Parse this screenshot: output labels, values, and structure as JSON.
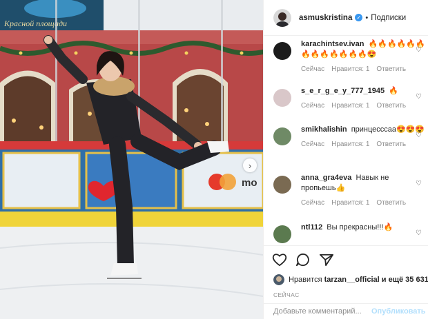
{
  "photo": {
    "sign_text": "Красной площади",
    "ad_text": "mo"
  },
  "header": {
    "username": "asmuskristina",
    "verified_mark": "✓",
    "separator": "•",
    "follow_label": "Подписки"
  },
  "comments": [
    {
      "username": "karachintsev.ivan",
      "text": "🔥🔥🔥🔥🔥🔥🔥🔥🔥🔥🔥🔥🔥😍",
      "time": "Сейчас",
      "likes": "Нравится: 1",
      "reply": "Ответить",
      "avatar_color": "#1b1b1b"
    },
    {
      "username": "s_e_r_g_e_y_777_1945",
      "text": "🔥",
      "time": "Сейчас",
      "likes": "Нравится: 1",
      "reply": "Ответить",
      "avatar_color": "#d9c7c9"
    },
    {
      "username": "smikhalishin",
      "text": "принцесссаа😍😍😍",
      "time": "Сейчас",
      "likes": "Нравится: 1",
      "reply": "Ответить",
      "avatar_color": "#6f8a66"
    },
    {
      "username": "anna_gra4eva",
      "text": "Навык не пропьешь👍",
      "time": "Сейчас",
      "likes": "Нравится: 1",
      "reply": "Ответить",
      "avatar_color": "#7a6a52"
    },
    {
      "username": "ntl112",
      "text": "Вы прекрасны!!!🔥",
      "time": "",
      "likes": "",
      "reply": "",
      "avatar_color": "#5b7a4f"
    }
  ],
  "likes_line": {
    "prefix": "Нравится",
    "user": "tarzan__official",
    "suffix": "и ещё 35 631"
  },
  "timestamp": "СЕЙЧАС",
  "add_comment": {
    "placeholder": "Добавьте комментарий...",
    "publish_label": "Опубликовать"
  },
  "colors": {
    "verified": "#3897f0",
    "secondary_text": "#8e8e8e",
    "publish_disabled": "#b2dffc"
  }
}
